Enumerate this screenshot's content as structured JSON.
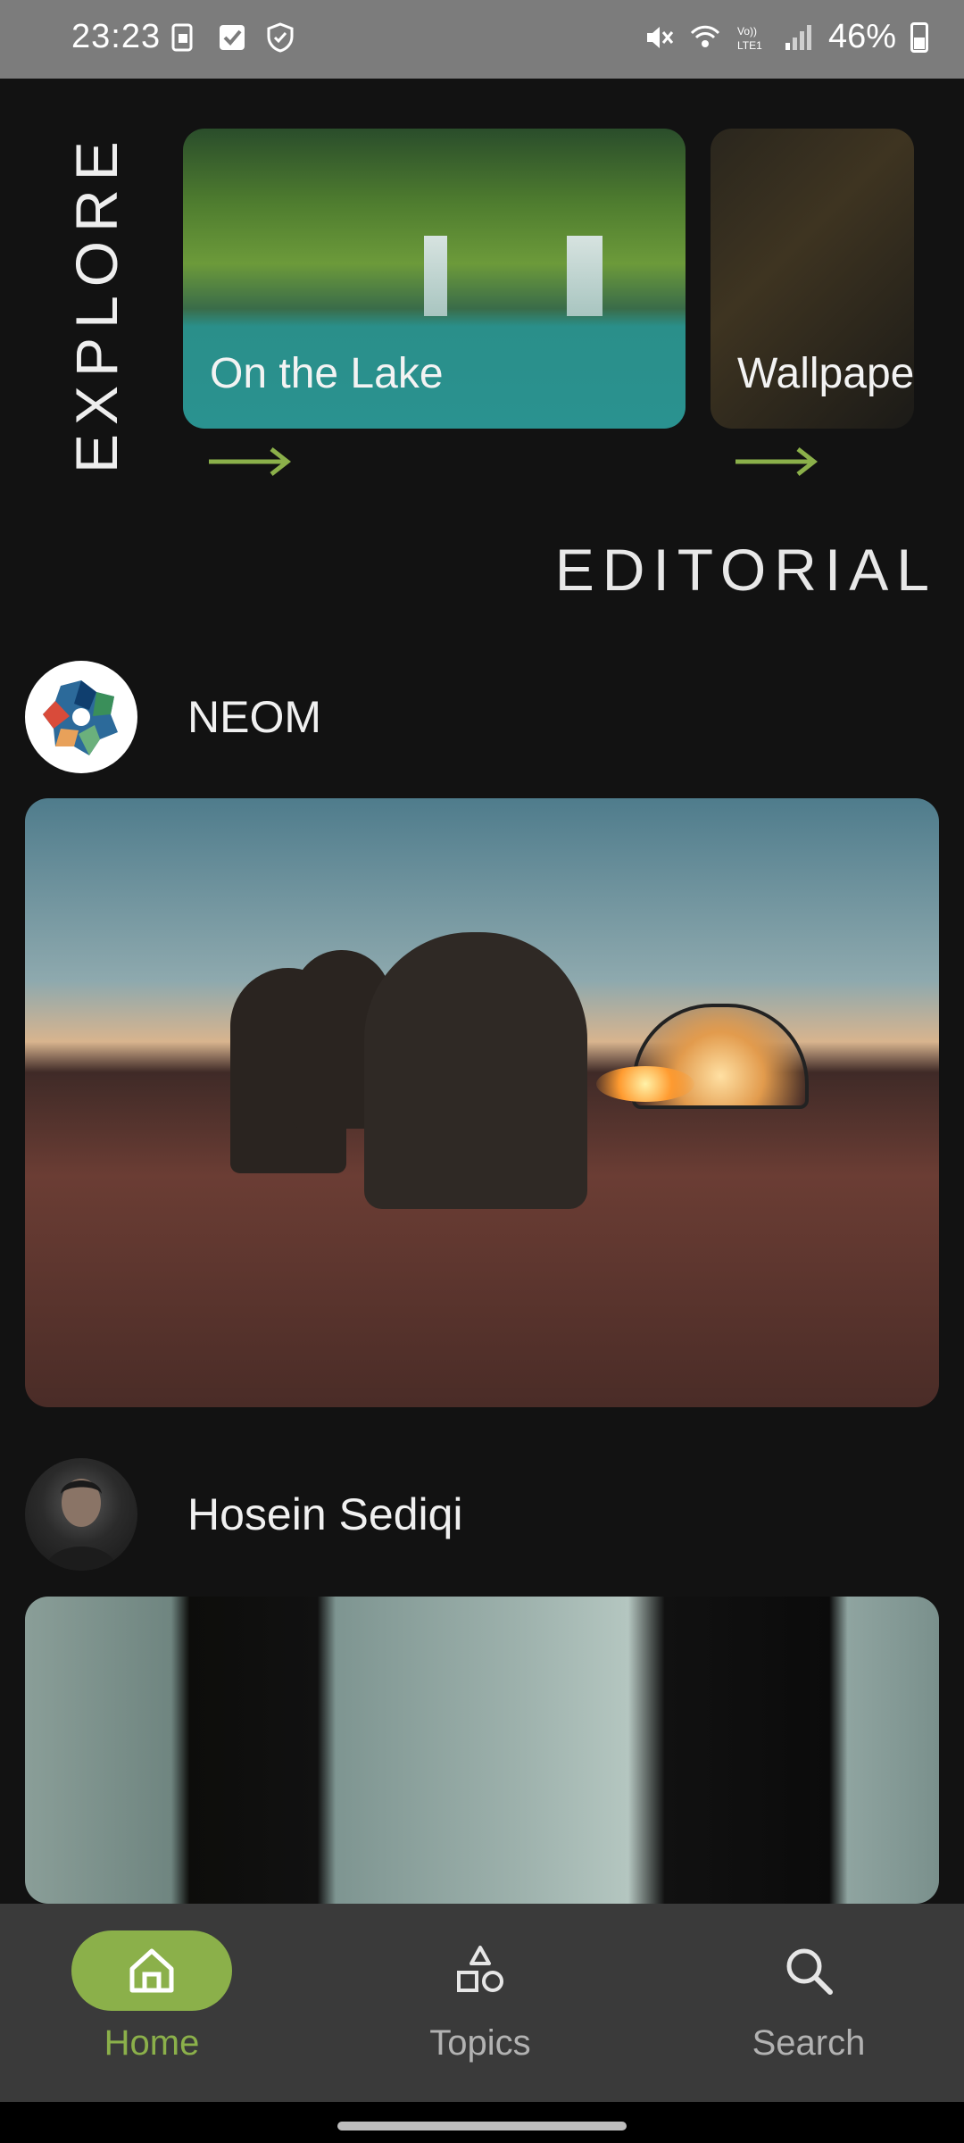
{
  "status_bar": {
    "time": "23:23",
    "battery": "46%",
    "icons": [
      "sim-icon",
      "check-icon",
      "shield-icon",
      "mute-icon",
      "wifi-icon",
      "volte-icon",
      "signal-icon",
      "battery-icon"
    ]
  },
  "explore": {
    "label": "EXPLORE",
    "cards": [
      {
        "title": "On the Lake"
      },
      {
        "title": "Wallpape"
      }
    ]
  },
  "editorial": {
    "label": "EDITORIAL"
  },
  "posts": [
    {
      "author": "NEOM"
    },
    {
      "author": "Hosein Sediqi"
    }
  ],
  "bottom_nav": {
    "items": [
      {
        "label": "Home",
        "icon": "home-icon",
        "active": true
      },
      {
        "label": "Topics",
        "icon": "shapes-icon",
        "active": false
      },
      {
        "label": "Search",
        "icon": "search-icon",
        "active": false
      }
    ]
  },
  "colors": {
    "accent": "#8bb04a",
    "background": "#121212",
    "nav_background": "#3a3a3a",
    "status_bar": "#7c7c7c"
  }
}
